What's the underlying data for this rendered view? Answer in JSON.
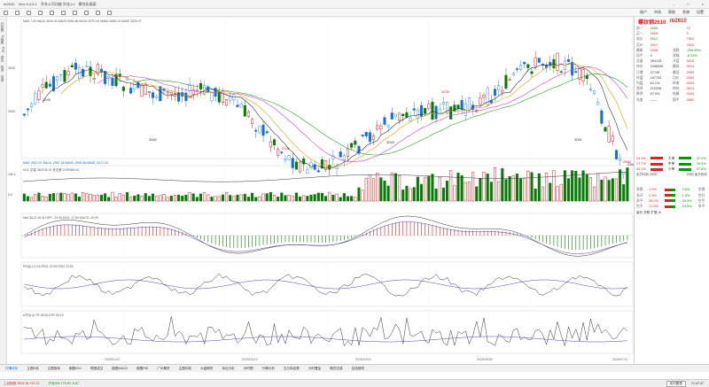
{
  "window": {
    "title": "rb2610",
    "menu": [
      "Vers 5.4.8.1",
      "开关公司功能 外挂1.0",
      "模块化画面"
    ]
  },
  "toolbar": {
    "right_items": [
      "账户",
      "市场",
      "帮助",
      "系统",
      "设置"
    ]
  },
  "left_tabs": [
    "分时图",
    "K线图",
    "F10",
    "资讯",
    "技术",
    "自选"
  ],
  "main_legend": "MA5 7.00 MA10 3026.40 MA20 3094.66 MA30 3070.40 MA60 3086.23 MA90 3226.07",
  "price_labels": [
    "3000",
    "2900"
  ],
  "annotations": [
    "3245",
    "3158",
    "3062",
    "2945",
    "3063",
    "3239",
    "3051",
    "2960",
    "2960"
  ],
  "vol_legend": "VOL 总量 384704.00 多空差 2399389.00",
  "vol_labels": [
    "100.1",
    "5.0"
  ],
  "macd_legend": "MACD(12,26,9) DIFF -23.09 DEA -17.64 MACD -10.90",
  "rsi_legend": "RSI(6,12,24) RSI1 22.95 RSI2 29.82",
  "atr_legend": "ATR(14) TR 28.00 ATR 39.19",
  "dates": [
    "2025/11/02",
    "2025/12/10",
    "2026/02/13",
    "2026/04/15",
    "2026/05/25",
    "2026/07/11"
  ],
  "ma_line_legend": "MA5: 2921.57 MA10: 2957.18 MA20: 2993.56 MA30: 3017.22",
  "quote": {
    "name": "螺纹钢2610",
    "code": "rb2610",
    "rows": [
      {
        "label": "卖一",
        "v1": "2930",
        "v2": "72"
      },
      {
        "label": "买一",
        "v1": "2929",
        "v2": "3"
      },
      {
        "label": "卖价",
        "v1": "2912",
        "v2": "7502"
      },
      {
        "label": "买价",
        "v1": "2907",
        "v2": "7610"
      },
      {
        "label": "最新",
        "v1": "2908",
        "l2": "涨跌",
        "v2": "-259.83%"
      },
      {
        "label": "现手",
        "v1": "4",
        "l2": "涨幅",
        "v2": "-8.03%"
      },
      {
        "label": "总量",
        "v1": "384128",
        "l2": "开盘",
        "v2": "3010"
      },
      {
        "label": "持仓",
        "v1": "2268399",
        "l2": "最高",
        "v2": "3014"
      },
      {
        "label": "日增",
        "v1": "37749",
        "l2": "最低",
        "v2": "2905"
      },
      {
        "label": "外盘",
        "v1": "197733",
        "l2": "均价",
        "v2": "2950"
      },
      {
        "label": "内盘",
        "v1": "62.1%",
        "l2": "昨收",
        "v2": "3004"
      },
      {
        "label": "涨停",
        "v1": "222036",
        "l2": "昨结",
        "v2": "3013"
      },
      {
        "label": "跌停",
        "v1": "57.9%",
        "l2": "结算",
        "v2": "3163"
      },
      {
        "label": "仓差",
        "v1": "——",
        "l2": "换手",
        "v2": "2862"
      }
    ],
    "flow": [
      {
        "l": "24.4%",
        "mid": "大单",
        "r": "37.2%"
      },
      {
        "l": "17.7%",
        "mid": "中单",
        "r": "29.4%"
      },
      {
        "l": "43.1%",
        "mid": "小单",
        "r": "37.8%"
      }
    ],
    "flow_foot_left": "买方均价 2930",
    "flow_foot_right": "2930 卖方均价",
    "stats": [
      {
        "l": "多换",
        "lv": "1.0%",
        "r": "空换",
        "rv": "2.6%"
      },
      {
        "l": "多开",
        "lv": "2.3%",
        "r": "空开",
        "rv": "1.3%"
      },
      {
        "l": "多平",
        "lv": "36.0%",
        "r": "空平",
        "rv": "26.3%"
      },
      {
        "l": "空平",
        "lv": "17.0%",
        "r": "多平",
        "rv": "24.5%"
      }
    ],
    "footer": "量价 关联 扩展 大"
  },
  "bottom_tabs": [
    "行情分析",
    "主图K线",
    "主图指标",
    "副图KDJ",
    "附图成交",
    "副图MACD",
    "副图RSI",
    "广州期货",
    "主图均线",
    "大盘期货",
    "持仓分析",
    "分时图",
    "行情分析",
    "五分钟走势",
    "分时叠加",
    "期货交易",
    "自选期货"
  ],
  "status": {
    "left1": "上证指数 3831.36 +51.12",
    "left2": "沪深300 775.90 -9.57",
    "right_btn": "实时图表",
    "time": "21:47:47"
  },
  "colors": {
    "up": "#d22222",
    "down": "#0a7a0a",
    "ma_blue": "#1e88e5",
    "ma_pink": "#cc44cc",
    "ma_black": "#333333"
  }
}
